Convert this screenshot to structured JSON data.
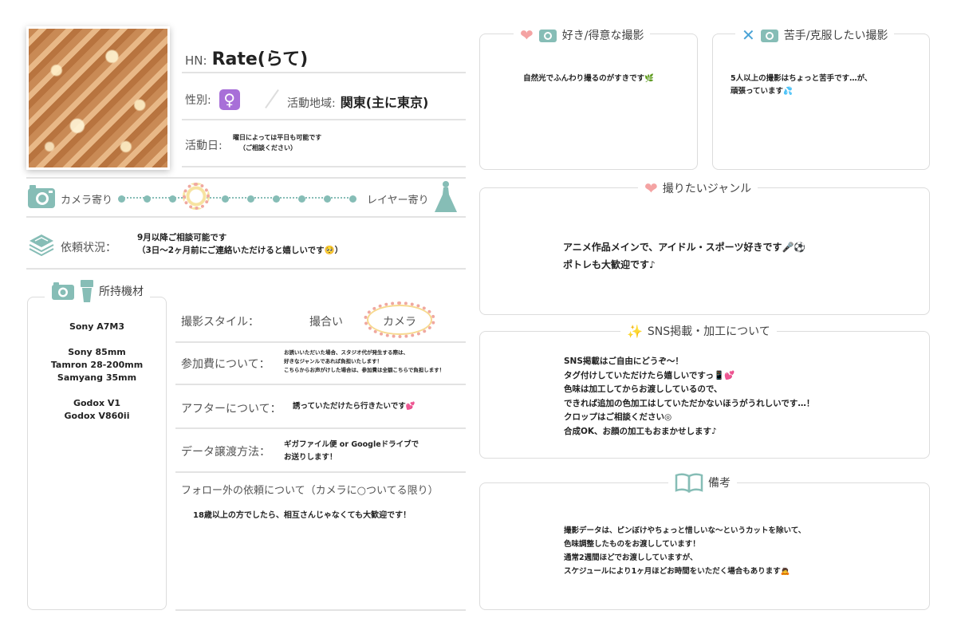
{
  "profile": {
    "hn_label": "HN:",
    "hn_value": "Rate(らて)",
    "gender_label": "性別:",
    "gender_symbol": "♀",
    "area_label": "活動地域:",
    "area_value": "関東(主に東京)",
    "activity_label": "活動日:",
    "activity_line1": "曜日によっては平日も可能です",
    "activity_line2": "（ご相談ください）"
  },
  "slider": {
    "left_label": "カメラ寄り",
    "right_label": "レイヤー寄り",
    "position_fraction": 0.25
  },
  "request": {
    "label": "依頼状況：",
    "line1": "9月以降ご相談可能です",
    "line2": "（3日〜2ヶ月前にご連絡いただけると嬉しいです🥺）"
  },
  "equipment": {
    "title": "所持機材",
    "items": [
      "Sony A7M3",
      "Sony 85mm",
      "Tamron 28-200mm",
      "Samyang 35mm",
      "Godox V1",
      "Godox V860ii"
    ]
  },
  "details": {
    "style_label": "撮影スタイル：",
    "style_option1": "撮合い",
    "style_option2": "カメラ",
    "fee_label": "参加費について：",
    "fee_line1": "お誘いいただいた場合、スタジオ代が発生する際は、",
    "fee_line2": "好きなジャンルであれば負担いたします！",
    "fee_line3": "こちらからお声がけした場合は、参加費は全額こちらで負担します！",
    "after_label": "アフターについて：",
    "after_value": "誘っていただけたら行きたいです💕",
    "data_label": "データ譲渡方法：",
    "data_line1": "ギガファイル便 or Googleドライブで",
    "data_line2": "お送りします！",
    "follow_label": "フォロー外の依頼について（カメラに○ついてる限り）",
    "follow_value": "18歳以上の方でしたら、相互さんじゃなくても大歓迎です！"
  },
  "cards": {
    "like_title": "好き/得意な撮影",
    "like_text": "自然光でふんわり撮るのがすきです🌿",
    "weak_title": "苦手/克服したい撮影",
    "weak_line1": "5人以上の撮影はちょっと苦手です…が、",
    "weak_line2": "頑張っています💦",
    "genre_title": "撮りたいジャンル",
    "genre_line1": "アニメ作品メインで、アイドル・スポーツ好きです🎤⚽",
    "genre_line2": "ポトレも大歓迎です♪",
    "sns_title": "SNS掲載・加工について",
    "sns_lines": [
      "SNS掲載はご自由にどうぞ〜！",
      "タグ付けしていただけたら嬉しいですっ📱💕",
      "色味は加工してからお渡ししているので、",
      "できれば追加の色加工はしていただかないほうがうれしいです…！",
      "クロップはご相談ください◎",
      "合成OK、お顔の加工もおまかせします♪"
    ],
    "notes_title": "備考",
    "notes_lines": [
      "撮影データは、ピンぼけやちょっと惜しいな〜というカットを除いて、",
      "色味調整したものをお渡ししています！",
      "通常2週間ほどでお渡ししていますが、",
      "スケジュールにより1ヶ月ほどお時間をいただく場合もあります🙇"
    ]
  },
  "icons": {
    "accent": "#86bdb6",
    "heart": "#f4a3a3"
  }
}
